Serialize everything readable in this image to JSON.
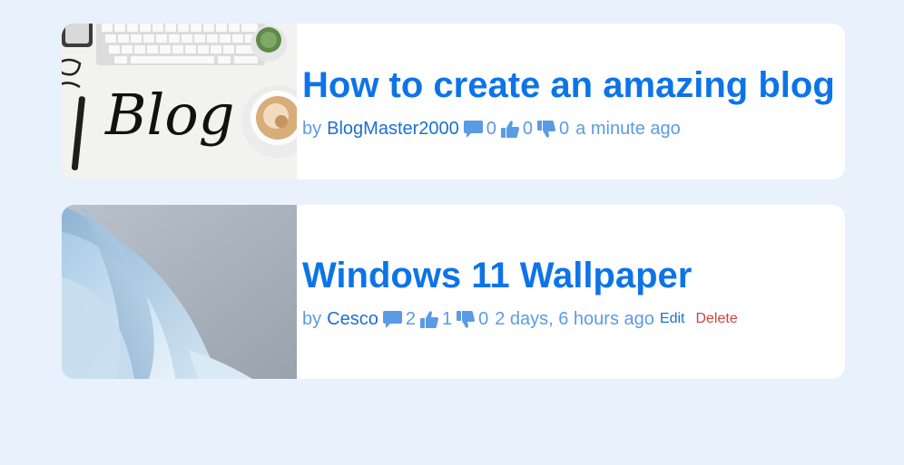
{
  "posts": [
    {
      "title": "How to create an amazing blog",
      "by_label": "by",
      "author": "BlogMaster2000",
      "comments": "0",
      "likes": "0",
      "dislikes": "0",
      "time": "a minute ago",
      "thumbnail_text": "Blog"
    },
    {
      "title": "Windows 11 Wallpaper",
      "by_label": "by",
      "author": "Cesco",
      "comments": "2",
      "likes": "1",
      "dislikes": "0",
      "time": "2 days, 6 hours ago",
      "edit_label": "Edit",
      "delete_label": "Delete"
    }
  ],
  "colors": {
    "page_background": "#e8f1fc",
    "card_background": "#ffffff",
    "title": "#0d74e8",
    "meta": "#5b9be6",
    "author": "#1a6fd4",
    "delete": "#d0443f"
  },
  "icons": {
    "comment": "comment-icon",
    "like": "thumbs-up-icon",
    "dislike": "thumbs-down-icon"
  }
}
